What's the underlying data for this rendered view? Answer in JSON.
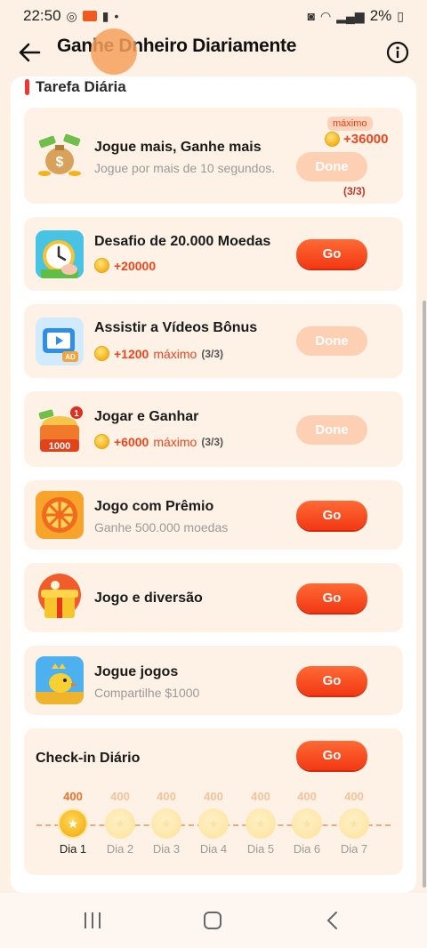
{
  "status": {
    "time": "22:50",
    "battery": "2%"
  },
  "header": {
    "title": "Ganhe Dnheiro Diariamente"
  },
  "section": {
    "title": "Tarefa Diária"
  },
  "tasks": [
    {
      "title": "Jogue mais, Ganhe mais",
      "subtitle": "Jogue por mais de 10 segundos.",
      "badge": "máximo",
      "reward": "+36000",
      "progress": "(3/3)",
      "button": "Done",
      "icon": "money-bag-icon"
    },
    {
      "title": "Desafio de 20.000 Moedas",
      "reward": "+20000",
      "button": "Go",
      "icon": "clock-icon"
    },
    {
      "title": "Assistir a Vídeos Bônus",
      "reward": "+1200",
      "reward_suffix": "máximo",
      "progress": "(3/3)",
      "button": "Done",
      "icon": "video-ad-icon"
    },
    {
      "title": "Jogar e Ganhar",
      "reward": "+6000",
      "reward_suffix": "máximo",
      "progress": "(3/3)",
      "button": "Done",
      "icon": "treasure-box-icon",
      "icon_badge": "1",
      "icon_caption": "1000"
    },
    {
      "title": "Jogo com Prêmio",
      "subtitle": "Ganhe 500.000 moedas",
      "button": "Go",
      "icon": "prize-wheel-icon"
    },
    {
      "title": "Jogo e diversão",
      "button": "Go",
      "icon": "gift-box-icon"
    },
    {
      "title": "Jogue jogos",
      "subtitle": "Compartilhe $1000",
      "button": "Go",
      "icon": "game-bird-icon"
    }
  ],
  "checkin": {
    "title": "Check-in Diário",
    "button": "Go",
    "days": [
      {
        "points": "400",
        "label": "Dia 1",
        "active": true
      },
      {
        "points": "400",
        "label": "Dia 2",
        "active": false
      },
      {
        "points": "400",
        "label": "Dia 3",
        "active": false
      },
      {
        "points": "400",
        "label": "Dia 4",
        "active": false
      },
      {
        "points": "400",
        "label": "Dia 5",
        "active": false
      },
      {
        "points": "400",
        "label": "Dia 6",
        "active": false
      },
      {
        "points": "400",
        "label": "Dia 7",
        "active": false
      }
    ]
  },
  "colors": {
    "accent": "#f23814",
    "background": "#fdf1e6",
    "card": "#fef1e5",
    "done": "#fdd0b3"
  }
}
